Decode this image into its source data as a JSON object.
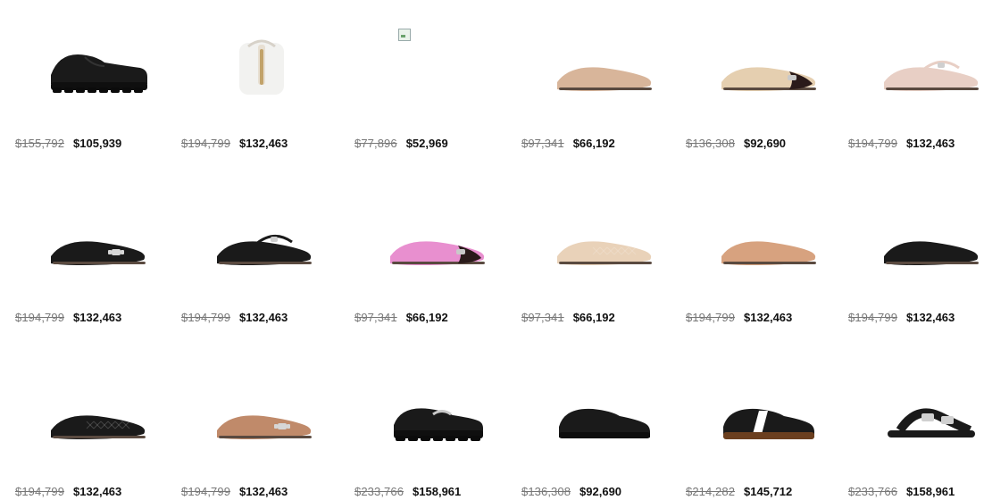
{
  "products": [
    {
      "old_price": "$155,792",
      "new_price": "$105,939",
      "icon": "black-lug-oxford-icon",
      "color": "#1a1a1a"
    },
    {
      "old_price": "$194,799",
      "new_price": "$132,463",
      "icon": "white-backpack-icon",
      "color": "#f2f2f0"
    },
    {
      "old_price": "$77,896",
      "new_price": "$52,969",
      "icon": "broken-image-icon",
      "color": "#e9f3ea"
    },
    {
      "old_price": "$97,341",
      "new_price": "$66,192",
      "icon": "nude-ballet-flat-icon",
      "color": "#d8b59a"
    },
    {
      "old_price": "$136,308",
      "new_price": "$92,690",
      "icon": "beige-captoe-flat-icon",
      "color": "#e5cfb0"
    },
    {
      "old_price": "$194,799",
      "new_price": "$132,463",
      "icon": "blush-mary-jane-flat-icon",
      "color": "#e8cfc5"
    },
    {
      "old_price": "$194,799",
      "new_price": "$132,463",
      "icon": "black-bow-flat-icon",
      "color": "#1a1a1a"
    },
    {
      "old_price": "$194,799",
      "new_price": "$132,463",
      "icon": "black-mary-jane-icon",
      "color": "#1a1a1a"
    },
    {
      "old_price": "$97,341",
      "new_price": "$66,192",
      "icon": "pink-captoe-flat-icon",
      "color": "#e88fcf"
    },
    {
      "old_price": "$97,341",
      "new_price": "$66,192",
      "icon": "cream-quilted-flat-icon",
      "color": "#e9d2b9"
    },
    {
      "old_price": "$194,799",
      "new_price": "$132,463",
      "icon": "tan-flat-icon",
      "color": "#d7a27f"
    },
    {
      "old_price": "$194,799",
      "new_price": "$132,463",
      "icon": "black-pointed-flat-icon",
      "color": "#1a1a1a"
    },
    {
      "old_price": "$194,799",
      "new_price": "$132,463",
      "icon": "black-quilted-flat-icon",
      "color": "#1a1a1a"
    },
    {
      "old_price": "$194,799",
      "new_price": "$132,463",
      "icon": "tan-bow-flat-icon",
      "color": "#c08a6a"
    },
    {
      "old_price": "$233,766",
      "new_price": "$158,961",
      "icon": "black-lug-loafer-icon",
      "color": "#1a1a1a"
    },
    {
      "old_price": "$136,308",
      "new_price": "$92,690",
      "icon": "black-sneaker-icon",
      "color": "#1a1a1a"
    },
    {
      "old_price": "$214,282",
      "new_price": "$145,712",
      "icon": "black-white-sneaker-icon",
      "color": "#1a1a1a"
    },
    {
      "old_price": "$233,766",
      "new_price": "$158,961",
      "icon": "black-sandal-icon",
      "color": "#1a1a1a"
    }
  ]
}
